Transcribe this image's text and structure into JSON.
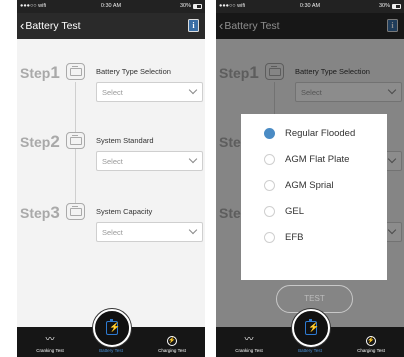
{
  "status_bar": {
    "carrier": "●●●○○ wifi",
    "time": "0:30 AM",
    "battery": "30%"
  },
  "header": {
    "back_label": "Battery Test",
    "info_icon": "info-icon"
  },
  "steps": [
    {
      "word": "Step",
      "number": "1",
      "label": "Battery Type Selection",
      "select_value": "Select"
    },
    {
      "word": "Step",
      "number": "2",
      "label": "System Standard",
      "select_value": "Select"
    },
    {
      "word": "Step",
      "number": "3",
      "label": "System Capacity",
      "select_value": "Select"
    }
  ],
  "battery_type_dialog": {
    "options": [
      {
        "label": "Regular Flooded",
        "selected": true
      },
      {
        "label": "AGM Flat Plate",
        "selected": false
      },
      {
        "label": "AGM Sprial",
        "selected": false
      },
      {
        "label": "GEL",
        "selected": false
      },
      {
        "label": "EFB",
        "selected": false
      }
    ]
  },
  "test_button": {
    "label": "TEST"
  },
  "tabs": [
    {
      "label": "Cranking Test",
      "icon": "waveform-icon",
      "active": false
    },
    {
      "label": "Battery Test",
      "icon": "battery-icon",
      "active": true
    },
    {
      "label": "Charging Test",
      "icon": "charging-icon",
      "active": false
    }
  ],
  "colors": {
    "accent": "#4a8bc4",
    "header_bg": "#2a2a2a",
    "tabbar_bg": "#161616"
  }
}
